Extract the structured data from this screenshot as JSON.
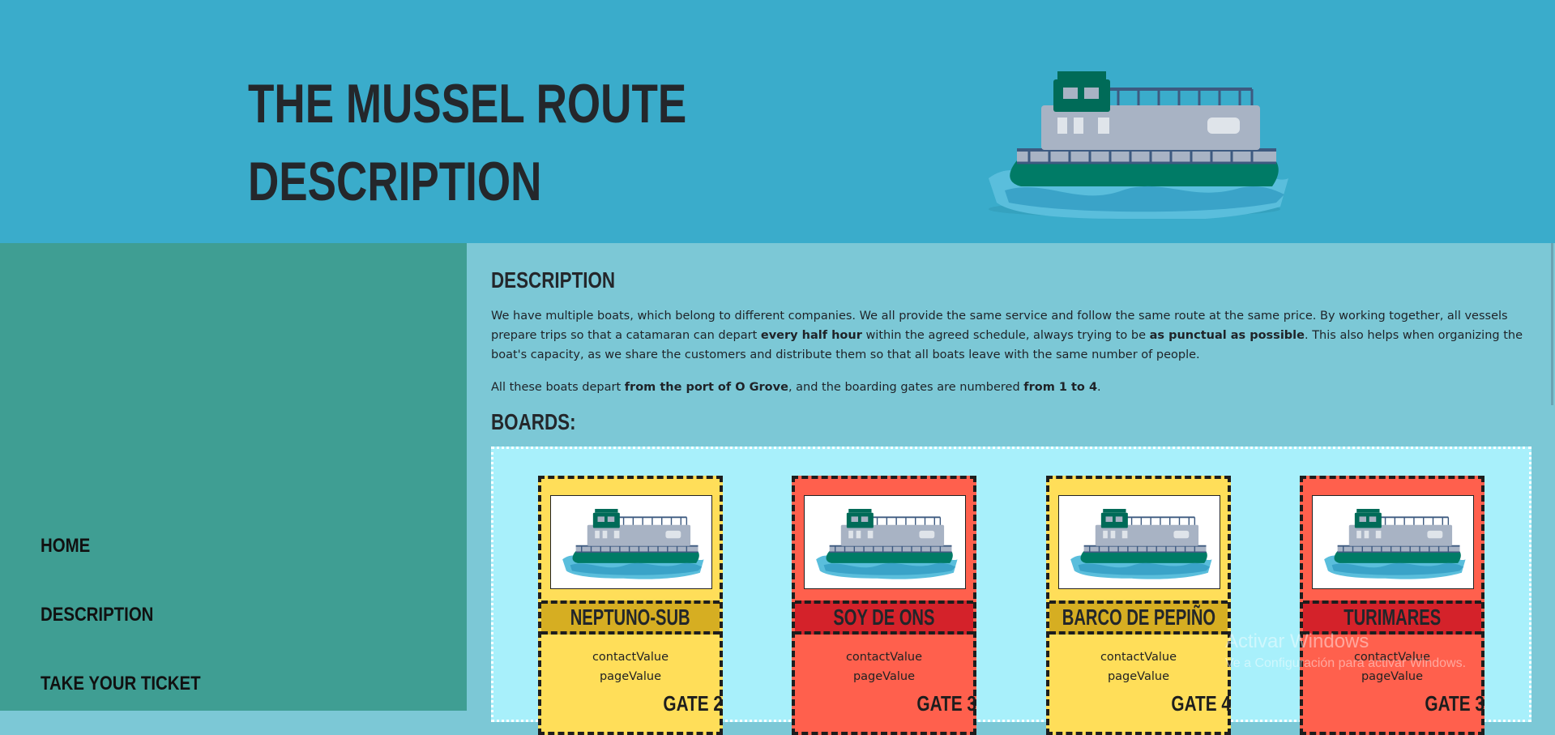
{
  "header": {
    "title_line1": "THE MUSSEL ROUTE",
    "title_line2": "DESCRIPTION",
    "logo_icon": "catamaran-boat-icon"
  },
  "nav": {
    "items": [
      {
        "label": "HOME"
      },
      {
        "label": "DESCRIPTION"
      },
      {
        "label": "TAKE YOUR TICKET"
      }
    ]
  },
  "main": {
    "heading": "DESCRIPTION",
    "p1": {
      "t1": "We have multiple boats, which belong to different companies. We all provide the same service and follow the same route at the same price. By working together, all vessels prepare trips so that a catamaran can depart ",
      "b1": "every half hour",
      "t2": " within the agreed schedule, always trying to be ",
      "b2": "as punctual as possible",
      "t3": ". This also helps when organizing the boat's capacity, as we share the customers and distribute them so that all boats leave with the same number of people."
    },
    "p2": {
      "t1": "All these boats depart ",
      "b1": "from the port of O Grove",
      "t2": ", and the boarding gates are numbered ",
      "b2": "from 1 to 4",
      "t3": "."
    },
    "boards_heading": "BOARDS:"
  },
  "boards": [
    {
      "name": "NEPTUNO-SUB",
      "contact": "contactValue",
      "page": "pageValue",
      "gate": "GATE 2",
      "color": "#ffde59"
    },
    {
      "name": "SOY DE ONS",
      "contact": "contactValue",
      "page": "pageValue",
      "gate": "GATE 3",
      "color": "#ff604d"
    },
    {
      "name": "BARCO DE PEPIÑO",
      "contact": "contactValue",
      "page": "pageValue",
      "gate": "GATE 4",
      "color": "#ffde59"
    },
    {
      "name": "TURIMARES",
      "contact": "contactValue",
      "page": "pageValue",
      "gate": "GATE 3",
      "color": "#ff604d"
    }
  ],
  "watermark": {
    "line1": "Activar Windows",
    "line2": "Ve a Configuración para activar Windows."
  },
  "colors": {
    "header_bg": "#3aaccb",
    "sidebar_bg": "#3f9e93",
    "main_bg": "#7cc8d6",
    "boards_bg": "#a8f0fb"
  }
}
